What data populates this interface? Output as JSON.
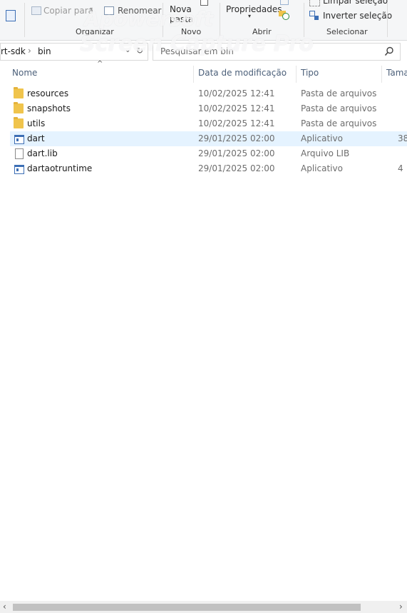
{
  "ribbon": {
    "copiar_para": "Copiar para",
    "renomear": "Renomear",
    "nova_pasta_line1": "Nova",
    "nova_pasta_line2": "pasta",
    "propriedades": "Propriedades",
    "limpar_selecao": "Limpar seleção",
    "inverter_selecao": "Inverter seleção",
    "groups": {
      "organizar": "Organizar",
      "novo": "Novo",
      "abrir": "Abrir",
      "selecionar": "Selecionar"
    }
  },
  "address": {
    "crumb1": "rt-sdk",
    "sep": "›",
    "crumb2": "bin",
    "search_placeholder": "Pesquisar em bin"
  },
  "columns": {
    "name": "Nome",
    "date": "Data de modificação",
    "type": "Tipo",
    "size": "Tama"
  },
  "files": [
    {
      "name": "resources",
      "date": "10/02/2025 12:41",
      "type": "Pasta de arquivos",
      "size": "",
      "icon": "folder-icon"
    },
    {
      "name": "snapshots",
      "date": "10/02/2025 12:41",
      "type": "Pasta de arquivos",
      "size": "",
      "icon": "folder-icon"
    },
    {
      "name": "utils",
      "date": "10/02/2025 12:41",
      "type": "Pasta de arquivos",
      "size": "",
      "icon": "folder-icon"
    },
    {
      "name": "dart",
      "date": "29/01/2025 02:00",
      "type": "Aplicativo",
      "size": "38",
      "icon": "application-icon",
      "selected": true
    },
    {
      "name": "dart.lib",
      "date": "29/01/2025 02:00",
      "type": "Arquivo LIB",
      "size": "",
      "icon": "file-icon"
    },
    {
      "name": "dartaotruntime",
      "date": "29/01/2025 02:00",
      "type": "Aplicativo",
      "size": "4",
      "icon": "application-icon"
    }
  ],
  "watermark": {
    "line1": "Apowersoft",
    "line2": "Screen Capture Pro"
  },
  "icons": {
    "sort_indicator": "chevron-up-icon",
    "refresh": "refresh-icon",
    "search": "search-icon",
    "scroll_left": "scroll-left-icon",
    "scroll_right": "scroll-right-icon"
  },
  "colors": {
    "selection": "#e5f3ff",
    "folder": "#f0c44c",
    "header_text": "#4c607a"
  }
}
